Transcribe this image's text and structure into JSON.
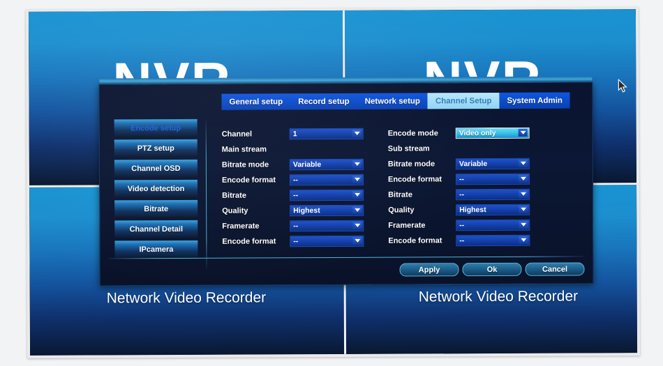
{
  "device": {
    "logo": "NVR",
    "label": "Network Video Recorder"
  },
  "background": {
    "quadrants": [
      {
        "name": "top-left",
        "logo": "NVR",
        "label": "Network Video Recorder"
      },
      {
        "name": "top-right",
        "logo": "NVR",
        "label": "Network Video Recorder"
      },
      {
        "name": "bottom-left",
        "logo": "",
        "label": ""
      },
      {
        "name": "bottom-right",
        "logo": "",
        "label": ""
      }
    ]
  },
  "dialog": {
    "tabs": [
      {
        "label": "General setup",
        "active": false
      },
      {
        "label": "Record setup",
        "active": false
      },
      {
        "label": "Network setup",
        "active": false
      },
      {
        "label": "Channel Setup",
        "active": true
      },
      {
        "label": "System Admin",
        "active": false
      }
    ],
    "sidebar": [
      {
        "label": "Encode setup",
        "active": true
      },
      {
        "label": "PTZ setup",
        "active": false
      },
      {
        "label": "Channel OSD",
        "active": false
      },
      {
        "label": "Video detection",
        "active": false
      },
      {
        "label": "Bitrate",
        "active": false
      },
      {
        "label": "Channel Detail",
        "active": false
      },
      {
        "label": "IPcamera",
        "active": false
      }
    ],
    "left_column": {
      "channel": {
        "label": "Channel",
        "value": "1"
      },
      "stream_header": "Main stream",
      "fields": [
        {
          "label": "Bitrate mode",
          "value": "Variable"
        },
        {
          "label": "Encode format",
          "value": "--"
        },
        {
          "label": "Bitrate",
          "value": "--"
        },
        {
          "label": "Quality",
          "value": "Highest"
        },
        {
          "label": "Framerate",
          "value": "--"
        },
        {
          "label": "Encode format",
          "value": "--"
        }
      ]
    },
    "right_column": {
      "encode_mode": {
        "label": "Encode mode",
        "value": "Video only",
        "focused": true
      },
      "stream_header": "Sub stream",
      "fields": [
        {
          "label": "Bitrate mode",
          "value": "Variable"
        },
        {
          "label": "Encode format",
          "value": "--"
        },
        {
          "label": "Bitrate",
          "value": "--"
        },
        {
          "label": "Quality",
          "value": "Highest"
        },
        {
          "label": "Framerate",
          "value": "--"
        },
        {
          "label": "Encode format",
          "value": "--"
        }
      ]
    },
    "buttons": [
      {
        "label": "Apply"
      },
      {
        "label": "Ok"
      },
      {
        "label": "Cancel"
      }
    ]
  },
  "colors": {
    "accent_blue": "#0f56e0",
    "active_tab_bg": "#8fd3f3",
    "active_tab_text": "#2f7fb8",
    "dialog_bg": "#0b1734",
    "focus_cyan": "#35bde8",
    "sidebar_active_text": "#1f5fd8",
    "separator": "#49b6d9"
  }
}
